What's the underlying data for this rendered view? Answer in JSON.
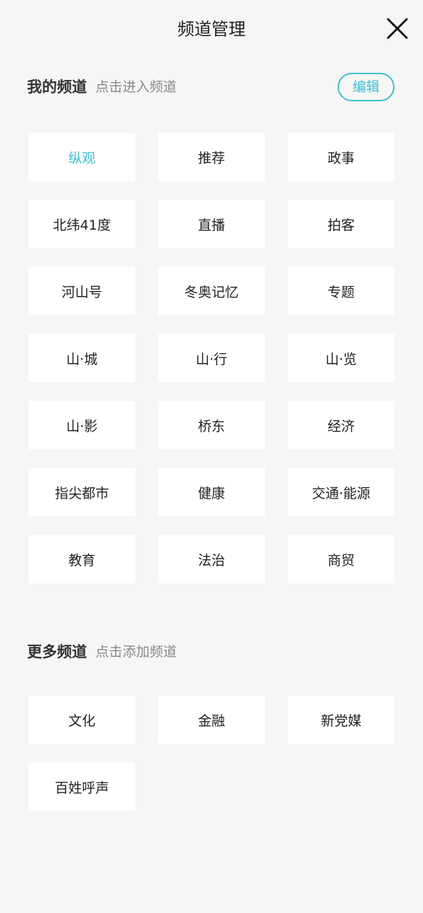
{
  "header": {
    "title": "频道管理",
    "close_icon": "close-icon"
  },
  "my_channels": {
    "title": "我的频道",
    "hint": "点击进入频道",
    "edit_label": "编辑",
    "accent_color": "#3fc0d0",
    "active_index": 0,
    "items": [
      "纵观",
      "推荐",
      "政事",
      "北纬41度",
      "直播",
      "拍客",
      "河山号",
      "冬奥记忆",
      "专题",
      "山·城",
      "山·行",
      "山·览",
      "山·影",
      "桥东",
      "经济",
      "指尖都市",
      "健康",
      "交通·能源",
      "教育",
      "法治",
      "商贸"
    ]
  },
  "more_channels": {
    "title": "更多频道",
    "hint": "点击添加频道",
    "items": [
      "文化",
      "金融",
      "新党媒",
      "百姓呼声"
    ]
  }
}
